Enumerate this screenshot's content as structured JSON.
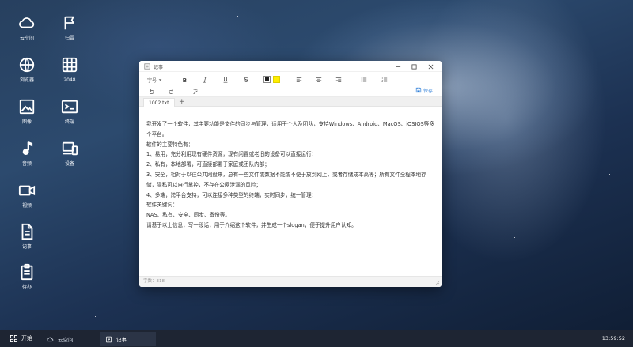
{
  "desktop": {
    "icons": [
      {
        "label": "云空间",
        "icon": "cloud-icon"
      },
      {
        "label": "扫雷",
        "icon": "flag-icon"
      },
      {
        "label": "浏览器",
        "icon": "globe-icon"
      },
      {
        "label": "2048",
        "icon": "grid-icon"
      },
      {
        "label": "图像",
        "icon": "image-icon"
      },
      {
        "label": "终端",
        "icon": "terminal-icon"
      },
      {
        "label": "音频",
        "icon": "music-icon"
      },
      {
        "label": "设备",
        "icon": "devices-icon"
      },
      {
        "label": "视频",
        "icon": "video-icon"
      },
      {
        "label": "记事",
        "icon": "note-icon"
      },
      {
        "label": "待办",
        "icon": "clipboard-icon"
      }
    ]
  },
  "window": {
    "title": "记事",
    "toolbar": {
      "font_size_label": "字号",
      "save_label": "保存",
      "text_color": "#222222",
      "highlight_color": "#ffee00"
    },
    "tabs": [
      {
        "label": "1002.txt"
      }
    ],
    "tab_add": "+",
    "content": [
      "我开发了一个软件，其主要功能是文件的同步与管理，适用于个人及团队，支持Windows、Android、MacOS、iOSIOS等多个平台。",
      "软件的主要特色有：",
      "1、易用，充分利用现有硬件资源，现有闲置或老旧的设备可以直接运行；",
      "2、私有，本地部署，可直接部署于家庭或团队内部；",
      "3、安全，相对于以往公共网盘来，总有一些文件或数据不能或不便于放到网上，或者存储成本高等；所有文件全程本地存储，隐私可以自行掌控，不存在公网泄漏的风险；",
      "4、多端，跨平台支持，可以连接多种类型的终端，实时同步，统一管理；",
      "软件关键词：",
      "NAS、私有、安全、同步、备份等。",
      "请基于以上信息，写一段话，用于介绍这个软件，并生成一个slogan，便于提升用户认知。"
    ],
    "status": "字数：318"
  },
  "taskbar": {
    "start_label": "开始",
    "items": [
      {
        "label": "云空间",
        "icon": "cloud-icon"
      },
      {
        "label": "记事",
        "icon": "note-icon"
      }
    ],
    "clock": "13:59:52"
  }
}
